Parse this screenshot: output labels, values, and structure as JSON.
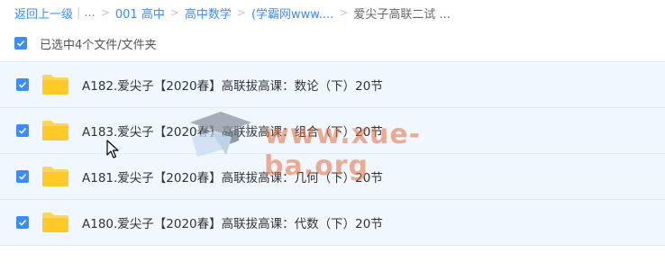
{
  "breadcrumb": {
    "back": "返回上一级",
    "ellipsis": "...",
    "items": [
      "001 高中",
      "高中数学",
      "(学霸网www....",
      "爱尖子高联二试 ..."
    ]
  },
  "selection": {
    "label": "已选中4个文件/文件夹"
  },
  "files": [
    {
      "name": "A182.爱尖子【2020春】高联拔高课：数论（下）20节",
      "checked": true,
      "icon": "folder-icon"
    },
    {
      "name": "A183.爱尖子【2020春】高联拔高课：组合（下）20节",
      "checked": true,
      "icon": "folder-icon"
    },
    {
      "name": "A181.爱尖子【2020春】高联拔高课：几何（下）20节",
      "checked": true,
      "icon": "folder-icon"
    },
    {
      "name": "A180.爱尖子【2020春】高联拔高课：代数（下）20节",
      "checked": true,
      "icon": "folder-icon"
    }
  ],
  "watermark": {
    "text": "www.xue-ba.org"
  },
  "colors": {
    "accent": "#3b8cff",
    "row_bg": "#f1f7fe",
    "folder": "#ffd35c"
  }
}
